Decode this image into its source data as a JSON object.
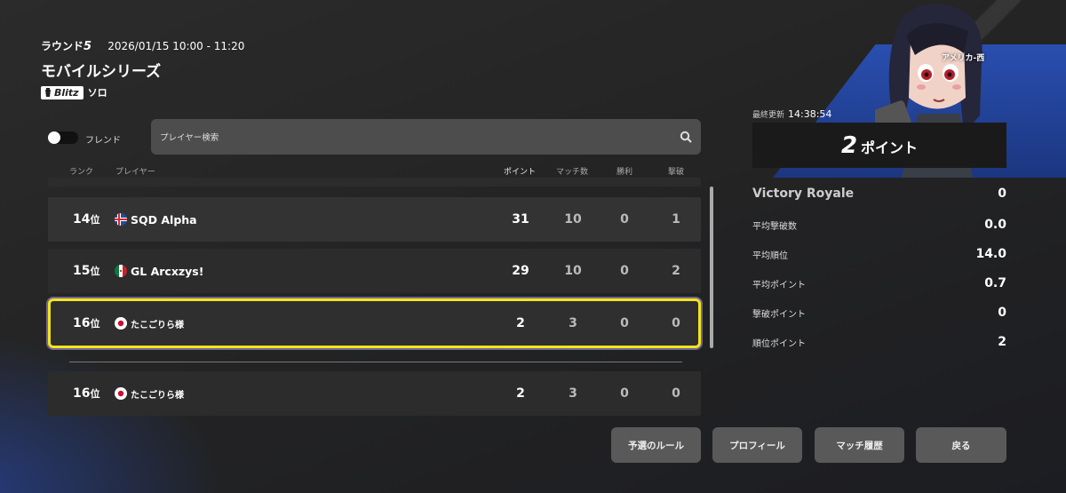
{
  "header": {
    "round_label": "ラウンド",
    "round_number": "5",
    "datetime": "2026/01/15 10:00 - 11:20",
    "title": "モバイルシリーズ",
    "mode_badge": "Blitz",
    "mode_label": "ソロ"
  },
  "region": "アメリカ-西",
  "filters": {
    "friend_toggle_label": "フレンド",
    "friend_toggle_on": false,
    "search_placeholder": "プレイヤー検索"
  },
  "columns": {
    "rank": "ランク",
    "player": "プレイヤー",
    "points": "ポイント",
    "matches": "マッチ数",
    "wins": "勝利",
    "eliminations": "撃破"
  },
  "rows": [
    {
      "rank": "14",
      "rank_suffix": "位",
      "flag": "iceland-flag",
      "name": "SQD Alpha",
      "points": "31",
      "matches": "10",
      "wins": "0",
      "elims": "1"
    },
    {
      "rank": "15",
      "rank_suffix": "位",
      "flag": "mexico-flag",
      "name": "GL Arcxzys!",
      "points": "29",
      "matches": "10",
      "wins": "0",
      "elims": "2"
    },
    {
      "rank": "16",
      "rank_suffix": "位",
      "flag": "japan-flag",
      "name": "たこごりら様",
      "points": "2",
      "matches": "3",
      "wins": "0",
      "elims": "0"
    }
  ],
  "own_row": {
    "rank": "16",
    "rank_suffix": "位",
    "flag": "japan-flag",
    "name": "たこごりら様",
    "points": "2",
    "matches": "3",
    "wins": "0",
    "elims": "0"
  },
  "summary": {
    "last_updated_label": "最終更新",
    "last_updated_time": "14:38:54",
    "points_value": "2",
    "points_unit": "ポイント",
    "stats": [
      {
        "label": "Victory Royale",
        "value": "0"
      },
      {
        "label": "平均撃破数",
        "value": "0.0"
      },
      {
        "label": "平均順位",
        "value": "14.0"
      },
      {
        "label": "平均ポイント",
        "value": "0.7"
      },
      {
        "label": "撃破ポイント",
        "value": "0"
      },
      {
        "label": "順位ポイント",
        "value": "2"
      }
    ]
  },
  "buttons": {
    "rules": "予選のルール",
    "profile": "プロフィール",
    "match_history": "マッチ履歴",
    "back": "戻る"
  },
  "colors": {
    "highlight": "#f2e51d",
    "accent_blue": "#2a56c8"
  }
}
